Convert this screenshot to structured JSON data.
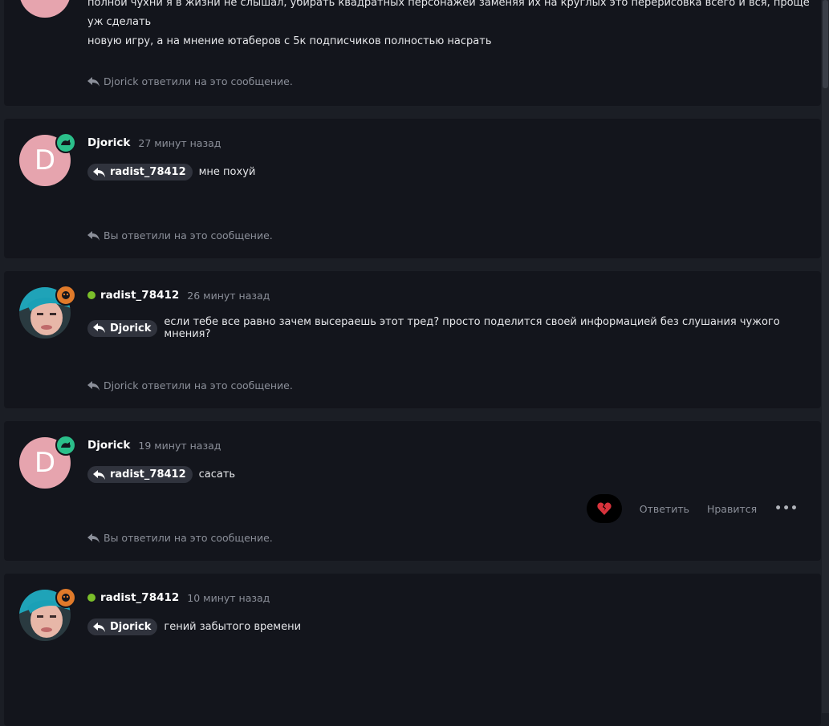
{
  "posts": [
    {
      "text_line1": "полной чухни я в жизни не слышал, убирать квадратных персонажей заменяя их на круглых это перерисовка всего и вся, проще уж сделать",
      "text_line2": "новую игру, а на мнение ютаберов с 5к подписчиков полностью насрать",
      "reply_note": "Djorick ответили на это сообщение."
    },
    {
      "author": "Djorick",
      "avatar_letter": "D",
      "time": "27 минут назад",
      "mention": "radist_78412",
      "text": "мне похуй",
      "reply_note": "Вы ответили на это сообщение."
    },
    {
      "author": "radist_78412",
      "time": "26 минут назад",
      "mention": "Djorick",
      "text": "если тебе все равно зачем высераешь этот тред? просто поделится своей информацией без слушания чужого мнения?",
      "reply_note": "Djorick ответили на это сообщение."
    },
    {
      "author": "Djorick",
      "avatar_letter": "D",
      "time": "19 минут назад",
      "mention": "radist_78412",
      "text": "сасать",
      "reply_note": "Вы ответили на это сообщение.",
      "actions": {
        "reply": "Ответить",
        "like": "Нравится",
        "more": "•••"
      }
    },
    {
      "author": "radist_78412",
      "time": "10 минут назад",
      "mention": "Djorick",
      "text": "гений забытого времени"
    }
  ],
  "colors": {
    "page_bg": "#1b1e25",
    "post_bg": "#13151c",
    "online": "#7bbf2a",
    "badge_green": "#2bbf8a",
    "badge_orange": "#e07a2a"
  },
  "icons": [
    "reply-arrow-icon",
    "broken-heart-icon",
    "online-dot-icon",
    "rank-badge-icon"
  ]
}
